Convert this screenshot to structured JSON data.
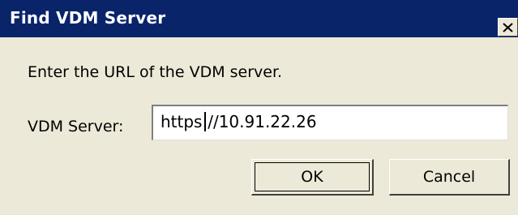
{
  "window": {
    "title": "Find VDM Server",
    "close_glyph": "X",
    "icons": {
      "close": "close-icon"
    }
  },
  "content": {
    "prompt": "Enter the URL of the VDM server.",
    "server_label": "VDM Server:",
    "server_value": "https://10.91.22.26"
  },
  "buttons": {
    "ok_label": "OK",
    "cancel_label": "Cancel"
  },
  "colors": {
    "titlebar": "#0a246a",
    "face": "#ece9d8"
  }
}
